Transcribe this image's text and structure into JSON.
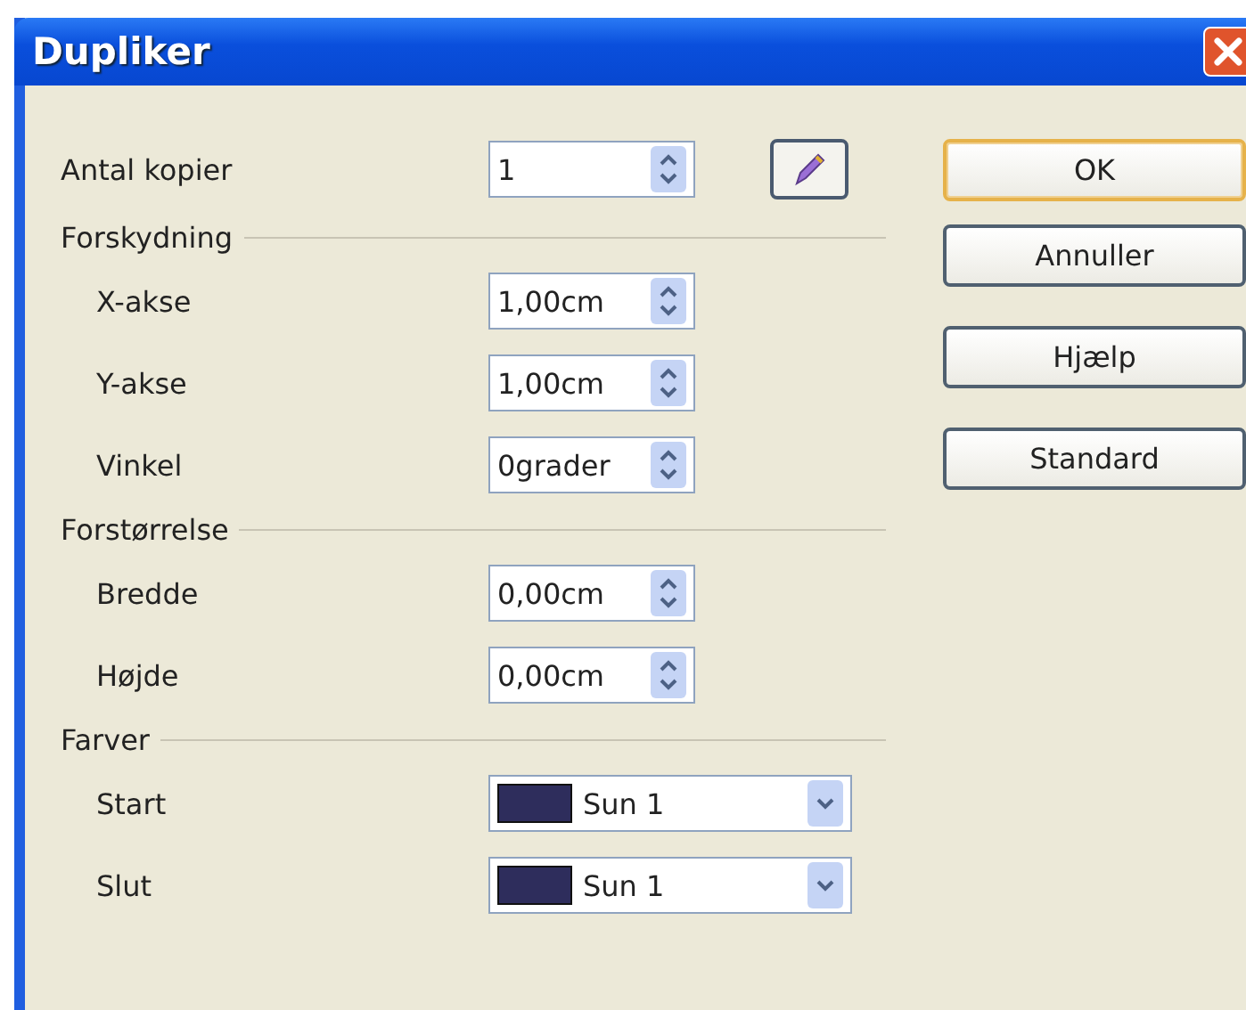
{
  "window": {
    "title": "Dupliker"
  },
  "copies": {
    "label": "Antal kopier",
    "value": "1"
  },
  "groups": [
    {
      "heading": "Forskydning",
      "fields": [
        {
          "kind": "spin",
          "label": "X-akse",
          "value": "1,00cm"
        },
        {
          "kind": "spin",
          "label": "Y-akse",
          "value": "1,00cm"
        },
        {
          "kind": "spin",
          "label": "Vinkel",
          "value": "0grader"
        }
      ]
    },
    {
      "heading": "Forstørrelse",
      "fields": [
        {
          "kind": "spin",
          "label": "Bredde",
          "value": "0,00cm"
        },
        {
          "kind": "spin",
          "label": "Højde",
          "value": "0,00cm"
        }
      ]
    },
    {
      "heading": "Farver",
      "fields": [
        {
          "kind": "color",
          "label": "Start",
          "value": "Sun 1",
          "color": "#2e2d5c"
        },
        {
          "kind": "color",
          "label": "Slut",
          "value": "Sun 1",
          "color": "#2e2d5c"
        }
      ]
    }
  ],
  "buttons": [
    {
      "label": "OK",
      "default": true
    },
    {
      "label": "Annuller",
      "default": false
    },
    {
      "label": "Hjælp",
      "default": false
    },
    {
      "label": "Standard",
      "default": false
    }
  ]
}
